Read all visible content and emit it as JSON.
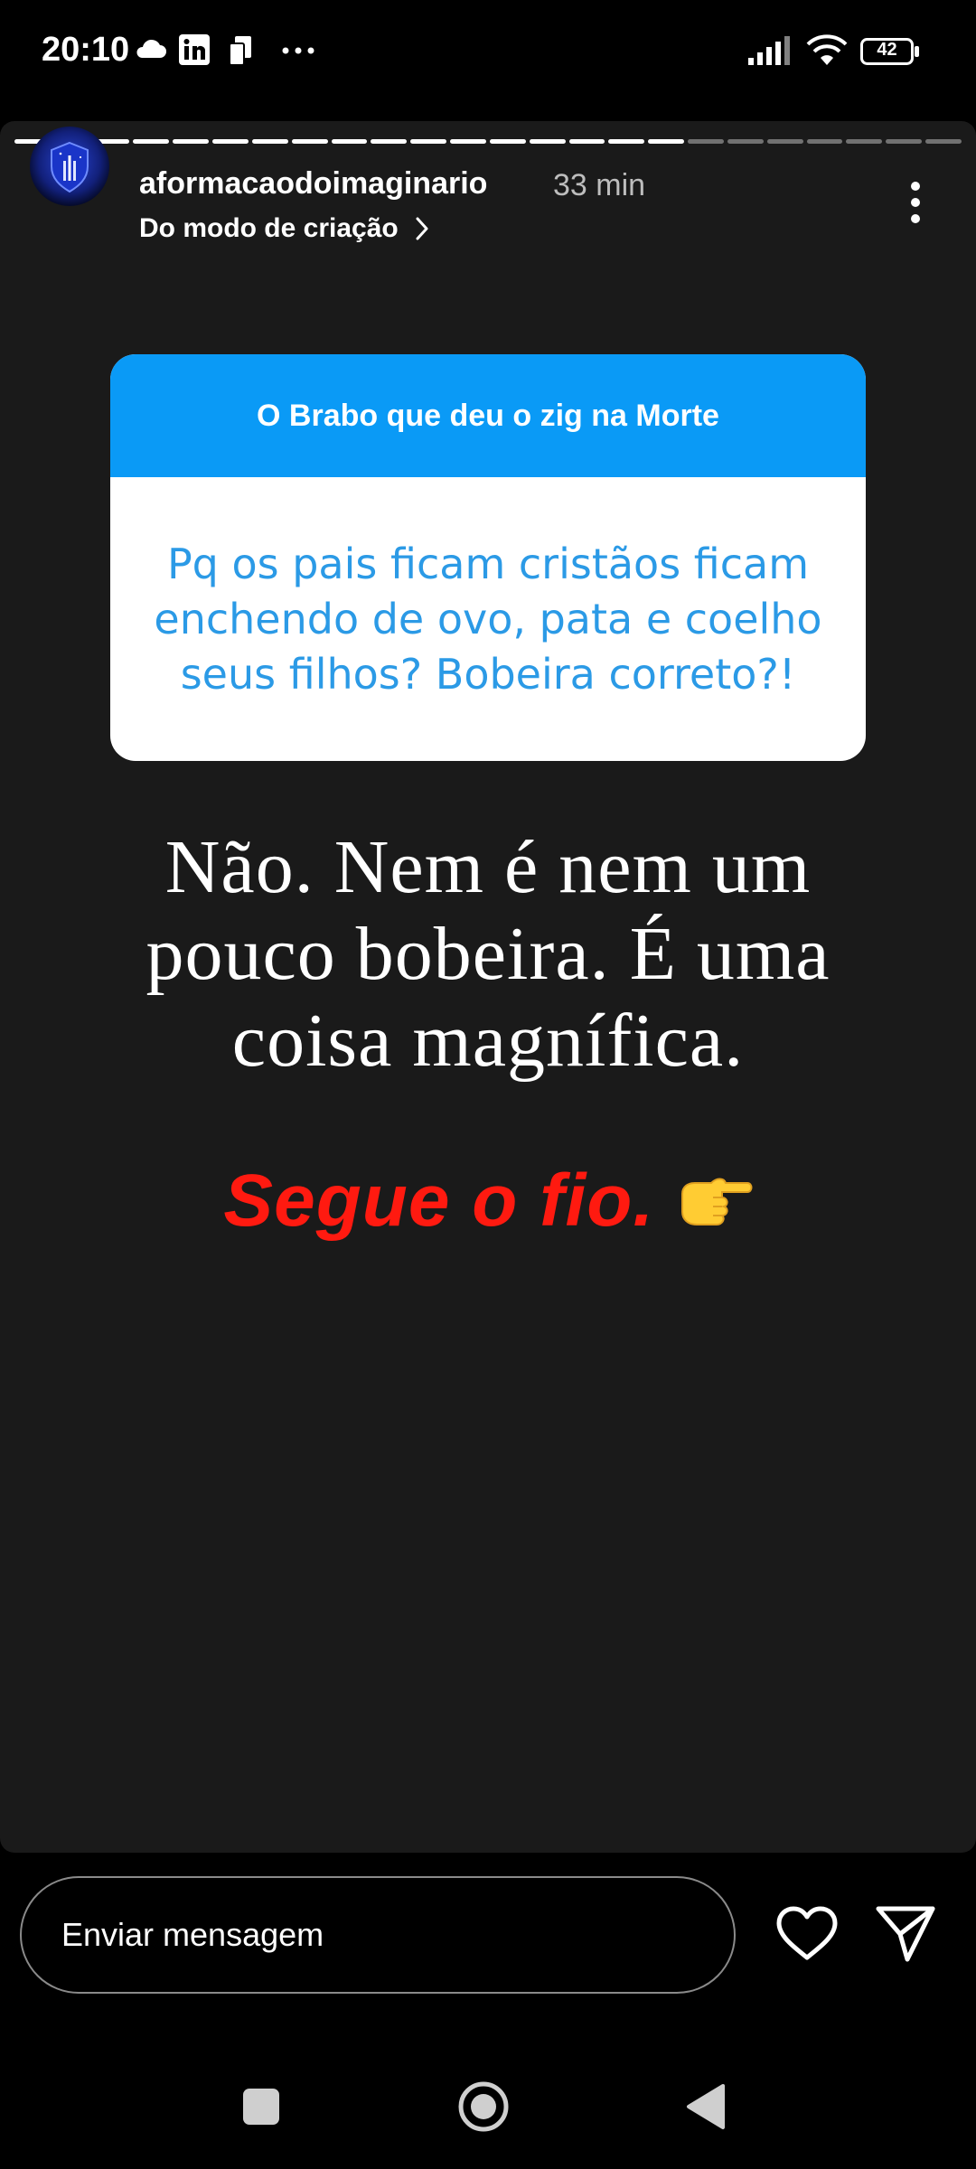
{
  "status_bar": {
    "time": "20:10",
    "icons": [
      "cloud-icon",
      "linkedin-icon",
      "sim-card-icon",
      "more-dots-icon",
      "signal-icon",
      "wifi-icon",
      "battery-icon"
    ],
    "battery_level": "42"
  },
  "story": {
    "progress_total": 24,
    "progress_done": 17,
    "username": "aformacaodoimaginario",
    "time_ago": "33 min",
    "subtitle": "Do modo de criação",
    "question": {
      "title": "O Brabo que deu o zig na Morte",
      "text": "Pq os pais ficam cristãos ficam enchendo de ovo, pata e coelho seus filhos? Bobeira correto?!"
    },
    "answer": {
      "line1": "Não. Nem é nem um",
      "line2": "pouco bobeira. É uma",
      "line3": "coisa magnífica."
    },
    "cta": "Segue o fio."
  },
  "bottom_bar": {
    "message_placeholder": "Enviar mensagem"
  },
  "colors": {
    "story_bg": "#1a1a1a",
    "sticker_header": "#0a9af6",
    "sticker_text": "#2b9ae6",
    "cta_red": "#ff1a10"
  }
}
